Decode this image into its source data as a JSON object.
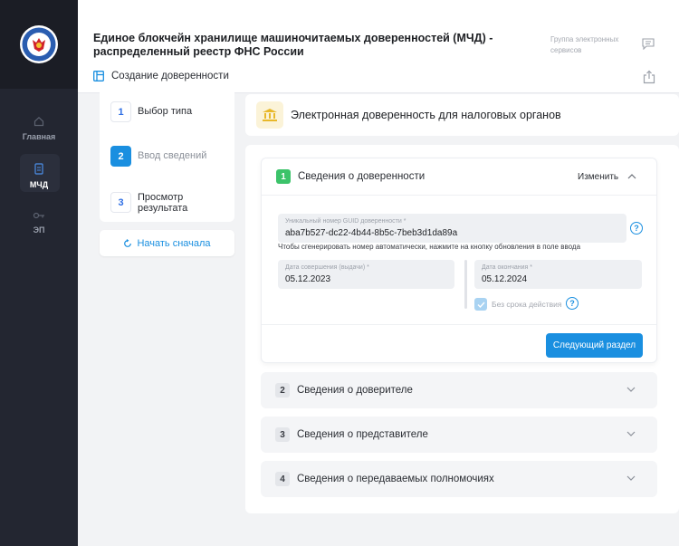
{
  "sidebar": {
    "items": [
      {
        "label": "Главная",
        "icon": "home-icon"
      },
      {
        "label": "МЧД",
        "icon": "document-icon"
      },
      {
        "label": "ЭП",
        "icon": "key-icon"
      }
    ],
    "active_index": 1
  },
  "header": {
    "title": "Единое блокчейн хранилище машиночитаемых доверенностей (МЧД) - распределенный реестр ФНС России",
    "group": "Группа электронных сервисов",
    "subtitle": "Создание доверенности"
  },
  "steps": [
    {
      "num": "1",
      "label": "Выбор типа"
    },
    {
      "num": "2",
      "label": "Ввод сведений"
    },
    {
      "num": "3",
      "label": "Просмотр результата"
    }
  ],
  "current_step": 2,
  "restart_label": "Начать сначала",
  "poa_type": "Электронная доверенность для налоговых органов",
  "sections": {
    "open": {
      "num": "1",
      "title": "Сведения о доверенности",
      "edit_label": "Изменить",
      "guid": {
        "label": "Уникальный номер GUID доверенности *",
        "value": "aba7b527-dc22-4b44-8b5c-7beb3d1da89a",
        "hint": "Чтобы сгенерировать номер автоматически, нажмите на кнопку обновления в поле ввода"
      },
      "date_issued": {
        "label": "Дата совершения (выдачи) *",
        "value": "05.12.2023"
      },
      "date_end": {
        "label": "Дата окончания *",
        "value": "05.12.2024"
      },
      "no_expiry_label": "Без срока действия",
      "no_expiry_checked": true,
      "next_label": "Следующий раздел"
    },
    "closed": [
      {
        "num": "2",
        "title": "Сведения о доверителе"
      },
      {
        "num": "3",
        "title": "Сведения о представителе"
      },
      {
        "num": "4",
        "title": "Сведения о передаваемых полномочиях"
      }
    ]
  },
  "colors": {
    "accent": "#1a8fe0",
    "success": "#3cc36a",
    "sidebar": "#232631",
    "sidebar_logo_bg": "#1b1d25"
  }
}
